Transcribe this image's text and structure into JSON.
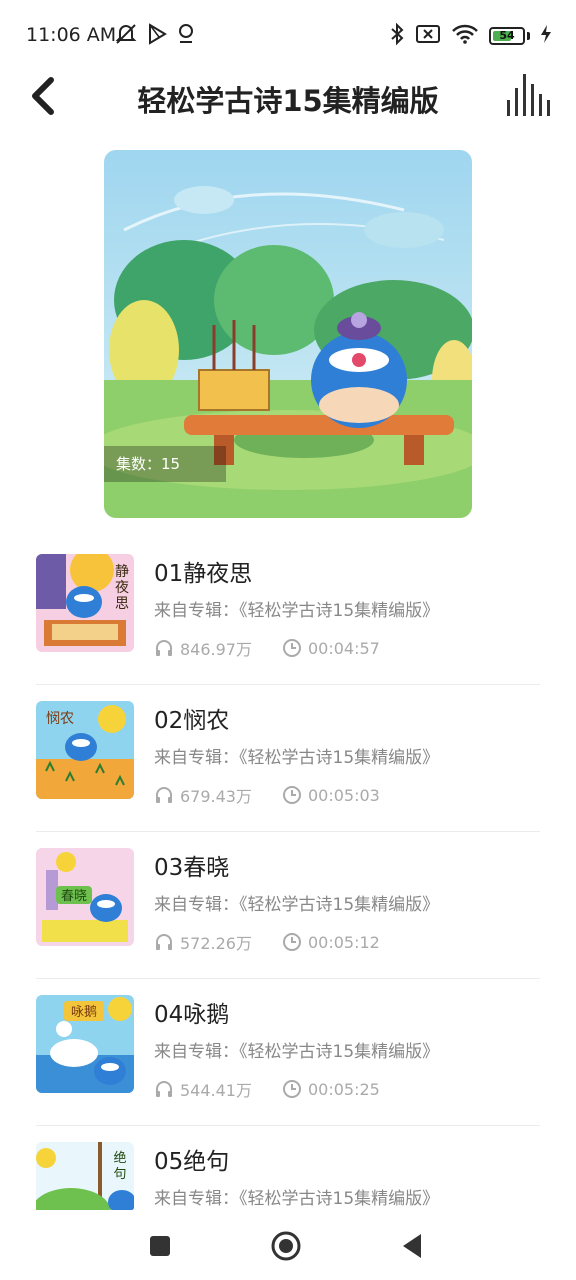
{
  "status_bar": {
    "time": "11:06 AM",
    "battery_level": "54",
    "icons": [
      "mute-icon",
      "play-store-icon",
      "location-icon",
      "bluetooth-icon",
      "sim-off-icon",
      "wifi-icon",
      "battery-icon",
      "charging-icon"
    ]
  },
  "header": {
    "title": "轻松学古诗15集精编版",
    "back_icon": "chevron-left-icon",
    "player_icon": "equalizer-bars-icon"
  },
  "cover": {
    "episode_count_label": "集数：15"
  },
  "tracks": [
    {
      "title": "01静夜思",
      "album": "来自专辑：《轻松学古诗15集精编版》",
      "plays": "846.97万",
      "duration": "00:04:57",
      "thumb_text": "静夜思"
    },
    {
      "title": "02悯农",
      "album": "来自专辑：《轻松学古诗15集精编版》",
      "plays": "679.43万",
      "duration": "00:05:03",
      "thumb_text": "悯农"
    },
    {
      "title": "03春晓",
      "album": "来自专辑：《轻松学古诗15集精编版》",
      "plays": "572.26万",
      "duration": "00:05:12",
      "thumb_text": "春晓"
    },
    {
      "title": "04咏鹅",
      "album": "来自专辑：《轻松学古诗15集精编版》",
      "plays": "544.41万",
      "duration": "00:05:25",
      "thumb_text": "咏鹅"
    },
    {
      "title": "05绝句",
      "album": "来自专辑：《轻松学古诗15集精编版》",
      "plays": "",
      "duration": "",
      "thumb_text": "绝句"
    }
  ],
  "nav_bar": {
    "buttons": [
      "recents-square-icon",
      "home-circle-icon",
      "back-triangle-icon"
    ]
  },
  "colors": {
    "accent_green": "#4caf50",
    "text_primary": "#222222",
    "text_secondary": "#888888",
    "text_meta": "#aaaaaa"
  }
}
